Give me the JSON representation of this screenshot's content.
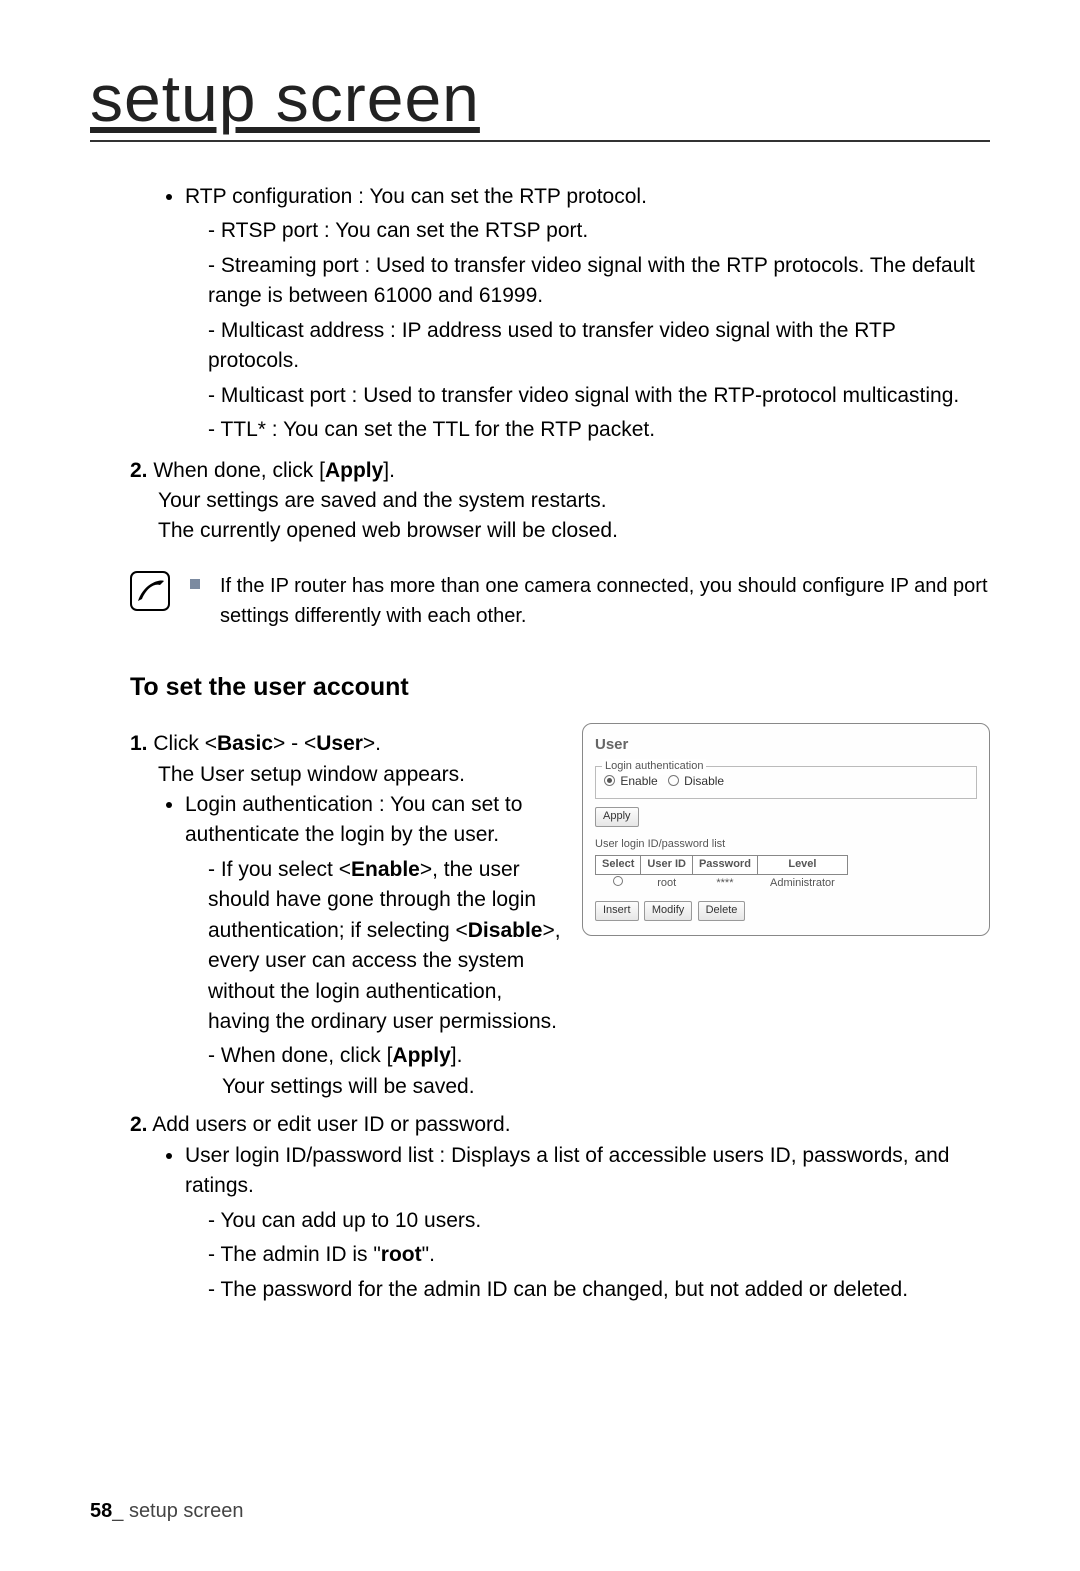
{
  "page_title": "setup screen",
  "rtp": {
    "intro": "RTP configuration : You can set the RTP protocol.",
    "items": [
      "RTSP port : You can set the RTSP port.",
      "Streaming port : Used to transfer video signal with the RTP protocols. The default range is between 61000 and 61999.",
      "Multicast address : IP address used to transfer video signal with the RTP protocols.",
      "Multicast port : Used to transfer video signal with the RTP-protocol multicasting.",
      "TTL* : You can set the TTL for the RTP packet."
    ]
  },
  "step2_prefix": "2.",
  "step2_a": "When done, click [",
  "step2_apply": "Apply",
  "step2_b": "].",
  "step2_line2": "Your settings are saved and the system restarts.",
  "step2_line3": "The currently opened web browser will be closed.",
  "note_text": "If the IP router has more than one camera connected, you should configure IP and port settings differently with each other.",
  "subheading": "To set the user account",
  "ua_step1_prefix": "1.",
  "ua_step1_a": "Click <",
  "ua_step1_basic": "Basic",
  "ua_step1_mid": "> - <",
  "ua_step1_user": "User",
  "ua_step1_b": ">.",
  "ua_step1_line2": "The User setup window appears.",
  "ua_bullet1": "Login authentication : You can set to authenticate the login by the user.",
  "ua_dash1_a": "If you select <",
  "ua_dash1_enable": "Enable",
  "ua_dash1_b": ">, the user should have gone through the login authentication; if selecting <",
  "ua_dash1_disable": "Disable",
  "ua_dash1_c": ">, every user can access the system without the login authentication, having the ordinary user permissions.",
  "ua_dash2_a": "When done, click [",
  "ua_dash2_apply": "Apply",
  "ua_dash2_b": "].",
  "ua_dash2_line2": "Your settings will be saved.",
  "ua_step2_prefix": "2.",
  "ua_step2_text": "Add users or edit user ID or password.",
  "ua_bullet2": "User login ID/password list : Displays a list of accessible users ID, passwords, and ratings.",
  "ua_sub_items_a": "You can add up to 10 users.",
  "ua_sub_items_b_pre": "The admin ID is \"",
  "ua_sub_items_b_root": "root",
  "ua_sub_items_b_post": "\".",
  "ua_sub_items_c": "The password for the admin ID can be changed, but not added or deleted.",
  "panel": {
    "title": "User",
    "legend1": "Login authentication",
    "enable": "Enable",
    "disable": "Disable",
    "apply": "Apply",
    "legend2": "User login ID/password list",
    "cols": {
      "select": "Select",
      "userid": "User ID",
      "password": "Password",
      "level": "Level"
    },
    "row": {
      "userid": "root",
      "password": "****",
      "level": "Administrator"
    },
    "btn_insert": "Insert",
    "btn_modify": "Modify",
    "btn_delete": "Delete"
  },
  "footer_page": "58",
  "footer_sep": "_ ",
  "footer_text": "setup screen"
}
